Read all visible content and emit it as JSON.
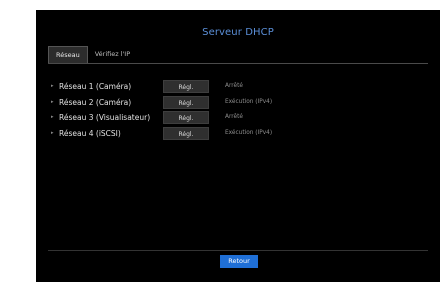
{
  "dialog": {
    "title": "Serveur DHCP"
  },
  "tabs": [
    {
      "label": "Réseau",
      "active": true
    },
    {
      "label": "Vérifiez l'IP",
      "active": false
    }
  ],
  "networks": [
    {
      "label": "Réseau 1 (Caméra)",
      "button": "Régl.",
      "status": "Arrêté"
    },
    {
      "label": "Réseau 2 (Caméra)",
      "button": "Régl.",
      "status": "Exécution (IPv4)"
    },
    {
      "label": "Réseau 3 (Visualisateur)",
      "button": "Régl.",
      "status": "Arrêté"
    },
    {
      "label": "Réseau 4 (iSCSI)",
      "button": "Régl.",
      "status": "Exécution (IPv4)"
    }
  ],
  "footer": {
    "return_label": "Retour"
  },
  "colors": {
    "panel_bg": "#000000",
    "title": "#5b8fd8",
    "accent_button": "#1f6fd6"
  }
}
